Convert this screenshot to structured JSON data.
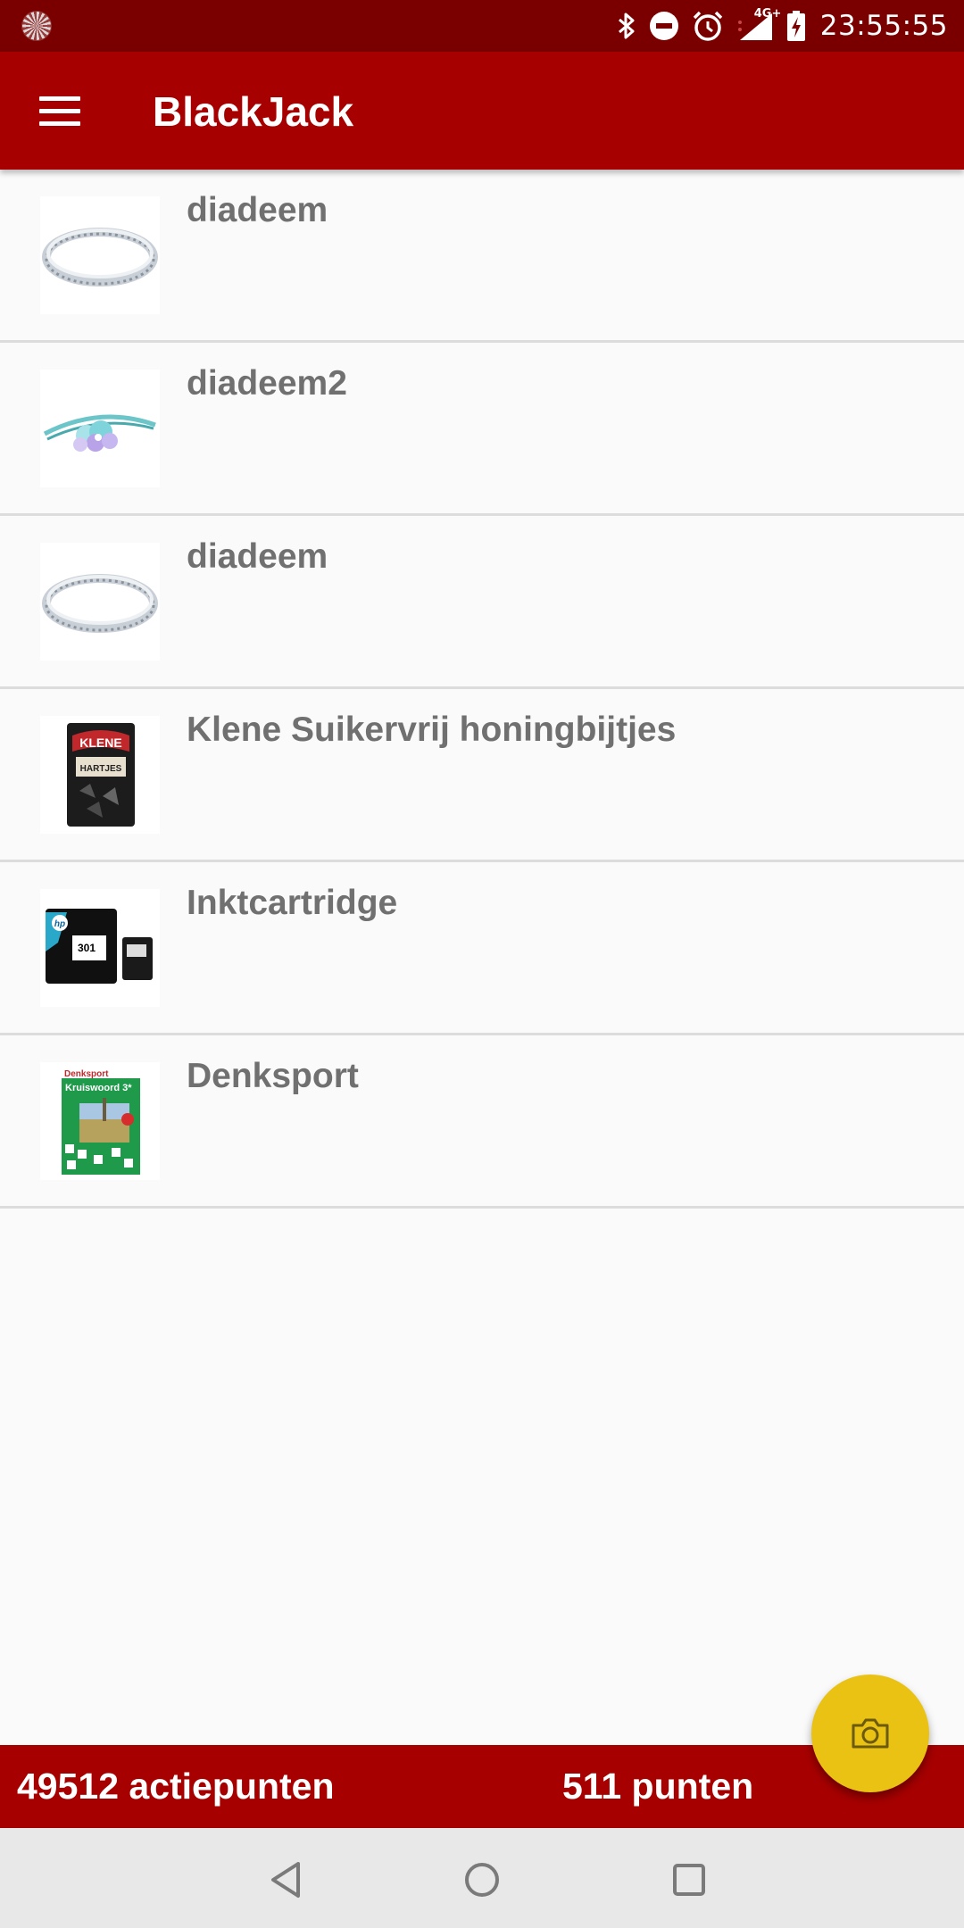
{
  "status_bar": {
    "time": "23:55:55",
    "network": "4G+",
    "icons": [
      "app-notification-icon",
      "bluetooth-icon",
      "do-not-disturb-icon",
      "alarm-icon",
      "signal-icon",
      "battery-charging-icon"
    ]
  },
  "app_bar": {
    "title": "BlackJack",
    "menu_icon": "hamburger-menu-icon"
  },
  "items": [
    {
      "title": "diadeem",
      "thumbnail": "sequin-headband"
    },
    {
      "title": "diadeem2",
      "thumbnail": "flower-headband"
    },
    {
      "title": "diadeem",
      "thumbnail": "sequin-headband"
    },
    {
      "title": "Klene Suikervrij honingbijtjes",
      "thumbnail": "candy-bag",
      "thumbnail_text": {
        "brand": "KLENE",
        "product": "HARTJES"
      }
    },
    {
      "title": "Inktcartridge",
      "thumbnail": "ink-cartridge",
      "thumbnail_text": {
        "brand": "hp",
        "model": "301"
      }
    },
    {
      "title": "Denksport",
      "thumbnail": "puzzle-book",
      "thumbnail_text": {
        "brand": "Denksport",
        "product": "Kruiswoord 3*"
      }
    }
  ],
  "footer": {
    "action_points": "49512 actiepunten",
    "points": "511 punten"
  },
  "fab": {
    "icon": "camera-icon"
  },
  "nav_bar": {
    "buttons": [
      "back-icon",
      "home-icon",
      "recents-icon"
    ]
  },
  "colors": {
    "status_bar": "#7a0000",
    "app_bar": "#a70000",
    "fab": "#e9c214",
    "item_text": "#707070",
    "background": "#fafafa"
  }
}
